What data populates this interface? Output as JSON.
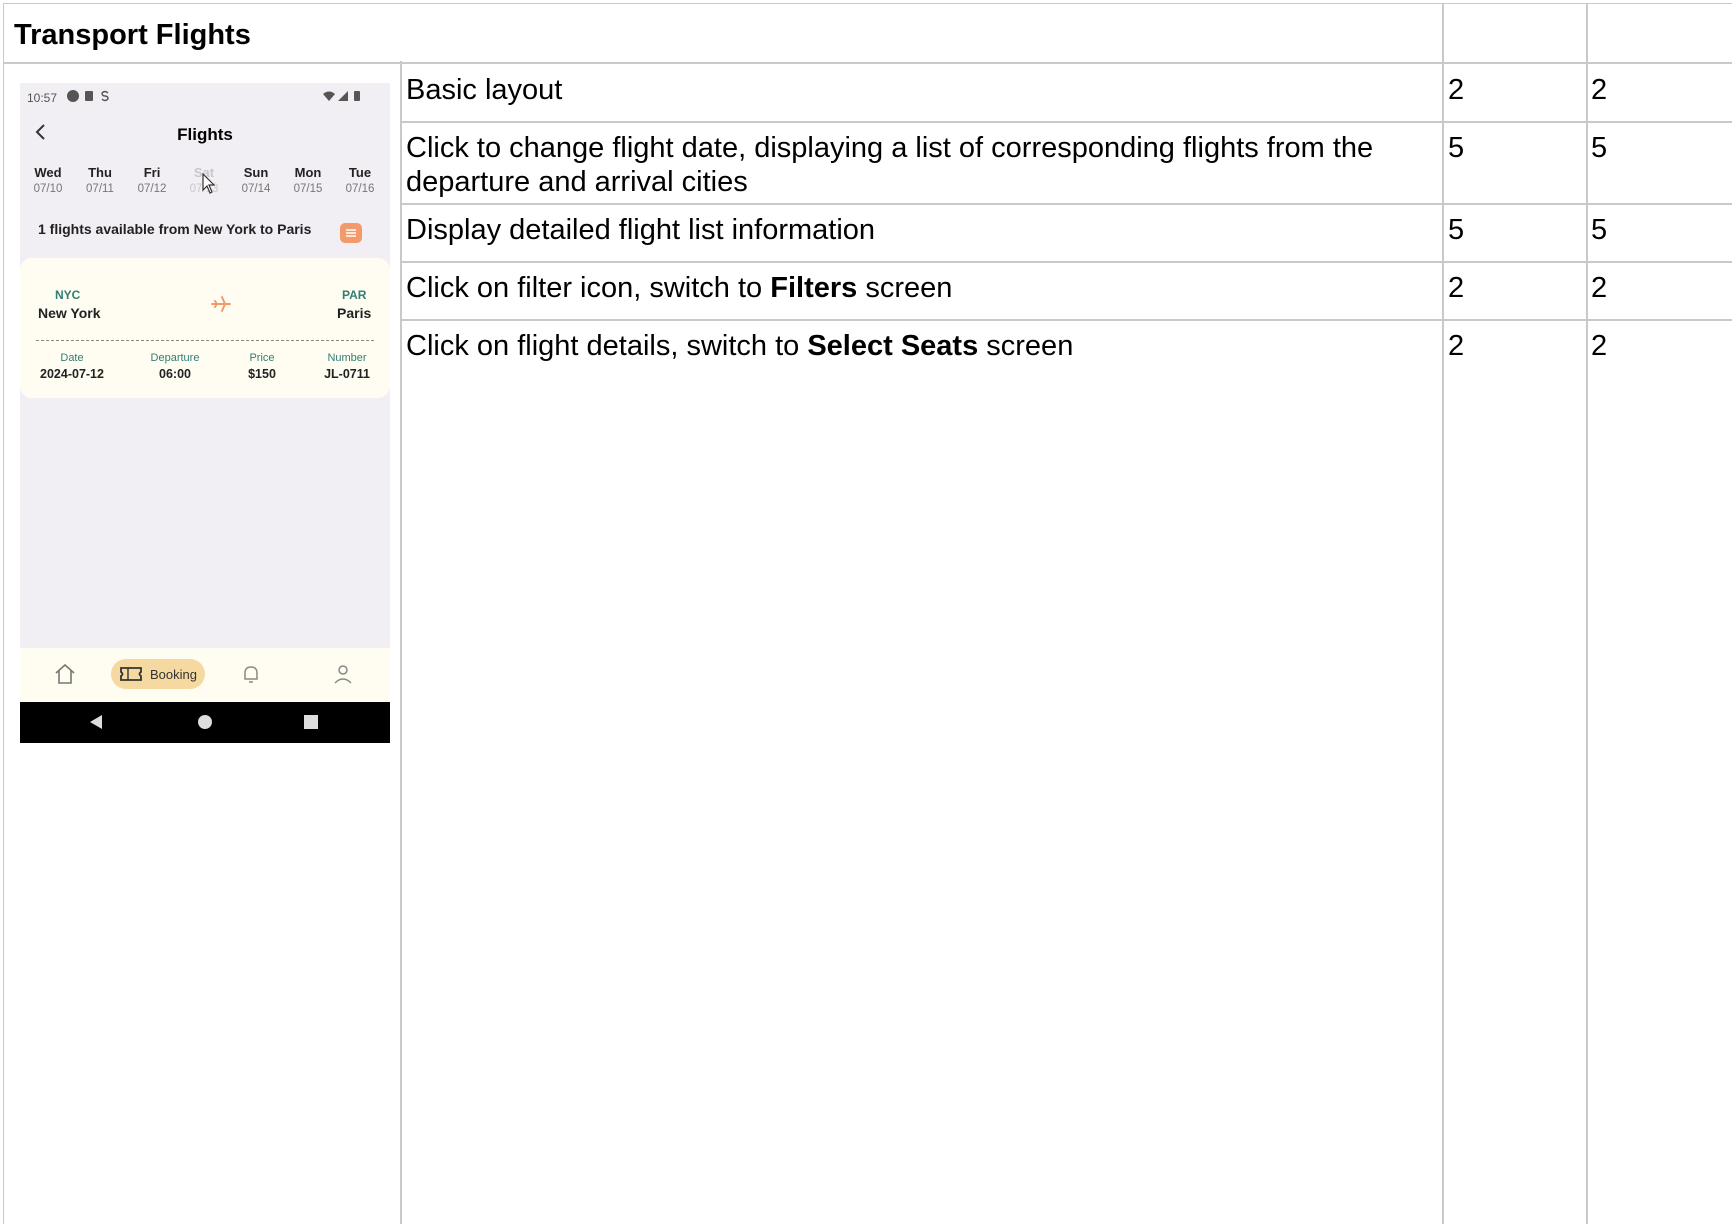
{
  "sheet": {
    "title": "Transport Flights",
    "rows": [
      {
        "parts": [
          {
            "text": "Basic layout",
            "bold": false
          }
        ],
        "score_a": "2",
        "score_b": "2"
      },
      {
        "parts": [
          {
            "text": "Click to change flight date, displaying a list of corresponding flights from the departure and arrival cities",
            "bold": false
          }
        ],
        "score_a": "5",
        "score_b": "5"
      },
      {
        "parts": [
          {
            "text": "Display detailed flight list information",
            "bold": false
          }
        ],
        "score_a": "5",
        "score_b": "5"
      },
      {
        "parts": [
          {
            "text": "Click on filter icon, switch to ",
            "bold": false
          },
          {
            "text": "Filters",
            "bold": true
          },
          {
            "text": " screen",
            "bold": false
          }
        ],
        "score_a": "2",
        "score_b": "2"
      },
      {
        "parts": [
          {
            "text": "Click on flight details, switch to ",
            "bold": false
          },
          {
            "text": "Select Seats",
            "bold": true
          },
          {
            "text": " screen",
            "bold": false
          }
        ],
        "score_a": "2",
        "score_b": "2"
      }
    ]
  },
  "phone": {
    "status": {
      "time": "10:57"
    },
    "title": "Flights",
    "days": [
      {
        "name": "Wed",
        "date": "07/10",
        "faded": false
      },
      {
        "name": "Thu",
        "date": "07/11",
        "faded": false
      },
      {
        "name": "Fri",
        "date": "07/12",
        "faded": false
      },
      {
        "name": "Sat",
        "date": "07/13",
        "faded": true
      },
      {
        "name": "Sun",
        "date": "07/14",
        "faded": false
      },
      {
        "name": "Mon",
        "date": "07/15",
        "faded": false
      },
      {
        "name": "Tue",
        "date": "07/16",
        "faded": false
      }
    ],
    "available_text": "1 flights available from New York to Paris",
    "flight": {
      "from_code": "NYC",
      "from_city": "New York",
      "to_code": "PAR",
      "to_city": "Paris",
      "date_label": "Date",
      "date": "2024-07-12",
      "departure_label": "Departure",
      "departure": "06:00",
      "price_label": "Price",
      "price": "$150",
      "number_label": "Number",
      "number": "JL-0711"
    },
    "nav": {
      "booking_label": "Booking"
    },
    "colors": {
      "accent": "#f29a6b",
      "teal": "#2f7d74",
      "pill": "#f6d9a0"
    },
    "icons": [
      "back-icon",
      "filter-icon",
      "plane-icon",
      "home-icon",
      "ticket-icon",
      "bell-icon",
      "user-icon"
    ]
  }
}
